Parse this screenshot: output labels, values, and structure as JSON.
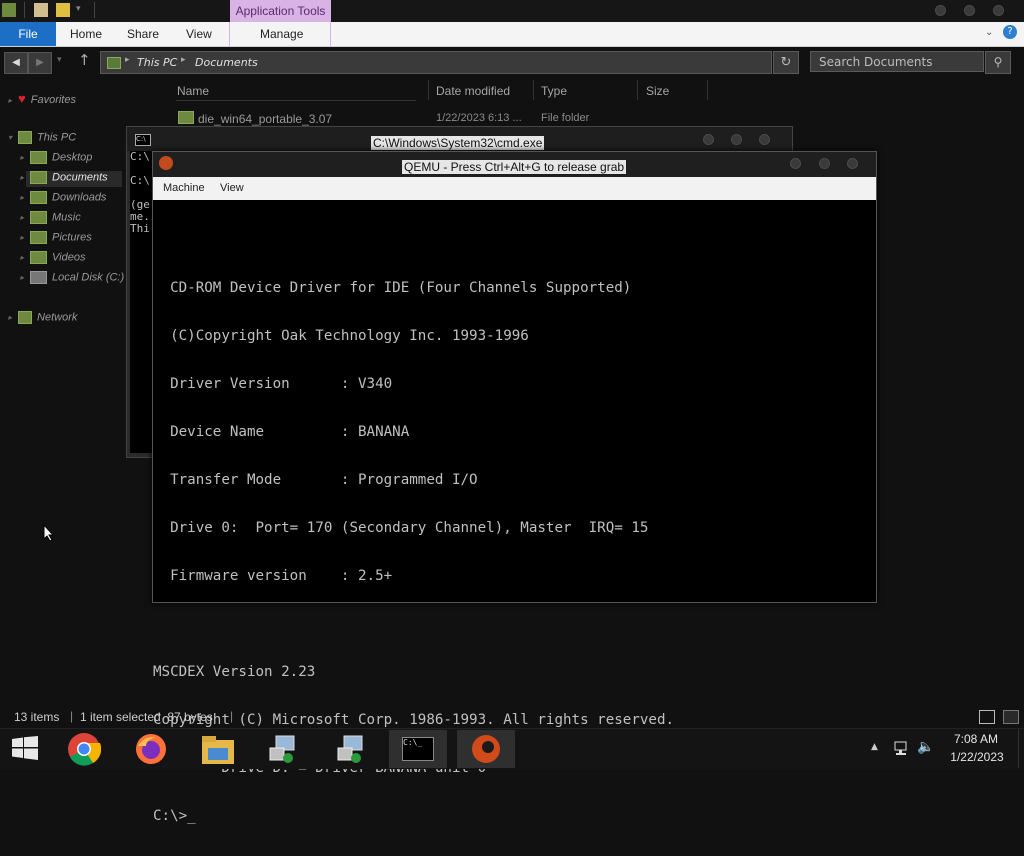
{
  "explorer": {
    "context_tab": "Application Tools",
    "ribbon_tabs": [
      "File",
      "Home",
      "Share",
      "View",
      "Manage"
    ],
    "breadcrumb": [
      "This PC",
      "Documents"
    ],
    "search_placeholder": "Search Documents",
    "columns": [
      "Name",
      "Date modified",
      "Type",
      "Size"
    ],
    "file_row": {
      "name": "die_win64_portable_3.07",
      "date": "1/22/2023 6:13 ...",
      "type": "File folder"
    },
    "nav": {
      "favorites": "Favorites",
      "this_pc": "This PC",
      "items": [
        "Desktop",
        "Documents",
        "Downloads",
        "Music",
        "Pictures",
        "Videos",
        "Local Disk (C:)"
      ],
      "network": "Network"
    },
    "status": {
      "count": "13 items",
      "selected": "1 item selected  87 bytes"
    }
  },
  "cmd": {
    "title": "C:\\Windows\\System32\\cmd.exe",
    "lines": [
      "C:\\",
      "",
      "C:\\",
      "",
      "(ge",
      "me.",
      "Thi"
    ]
  },
  "qemu": {
    "title": "QEMU - Press Ctrl+Alt+G to release grab",
    "menu": [
      "Machine",
      "View"
    ],
    "screen_lines": [
      "",
      "  CD-ROM Device Driver for IDE (Four Channels Supported)",
      "  (C)Copyright Oak Technology Inc. 1993-1996",
      "  Driver Version      : V340",
      "  Device Name         : BANANA",
      "  Transfer Mode       : Programmed I/O",
      "  Drive 0:  Port= 170 (Secondary Channel), Master  IRQ= 15",
      "  Firmware version    : 2.5+",
      "",
      "MSCDEX Version 2.23",
      "Copyright (C) Microsoft Corp. 1986-1993. All rights reserved.",
      "        Drive D: = Driver BANANA unit 0",
      "C:\\>_"
    ]
  },
  "taskbar": {
    "time": "7:08 AM",
    "date": "1/22/2023",
    "apps": [
      "start-button",
      "chrome-icon",
      "firefox-icon",
      "file-explorer-icon",
      "network-install-icon",
      "network-install-icon-2",
      "cmd-icon",
      "qemu-icon"
    ]
  },
  "colors": {
    "accent": "#1d6fc5",
    "context_tab": "#d9b3e6",
    "folder": "#6d8a3e"
  }
}
